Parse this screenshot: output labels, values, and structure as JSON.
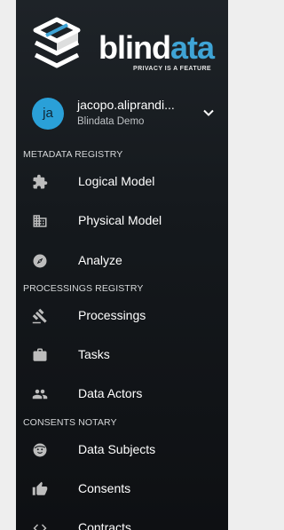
{
  "brand": {
    "name_prefix": "blind",
    "name_accent": "ata",
    "name_full": "blindata",
    "tagline": "PRIVACY IS A FEATURE",
    "accent_color": "#3fa4d6"
  },
  "user": {
    "initials": "ja",
    "username": "jacopo.aliprandi...",
    "organization": "Blindata Demo",
    "avatar_color": "#2aa0d8"
  },
  "sections": [
    {
      "title": "METADATA REGISTRY",
      "items": [
        {
          "label": "Logical Model",
          "icon": "puzzle-icon"
        },
        {
          "label": "Physical Model",
          "icon": "building-icon"
        },
        {
          "label": "Analyze",
          "icon": "compass-icon"
        }
      ]
    },
    {
      "title": "PROCESSINGS REGISTRY",
      "items": [
        {
          "label": "Processings",
          "icon": "gavel-icon"
        },
        {
          "label": "Tasks",
          "icon": "briefcase-icon"
        },
        {
          "label": "Data Actors",
          "icon": "people-icon"
        }
      ]
    },
    {
      "title": "CONSENTS NOTARY",
      "items": [
        {
          "label": "Data Subjects",
          "icon": "face-icon"
        },
        {
          "label": "Consents",
          "icon": "thumb-up-icon"
        },
        {
          "label": "Contracts",
          "icon": "code-icon"
        }
      ]
    }
  ]
}
